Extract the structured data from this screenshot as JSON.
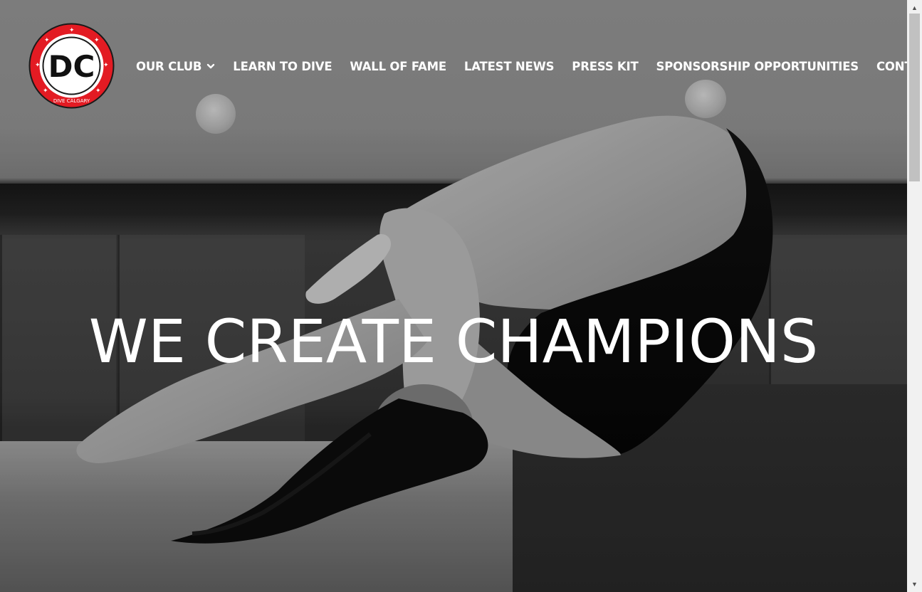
{
  "logo": {
    "initials": "DC",
    "ring_text": "DIVE CALGARY",
    "ring_color": "#e31b23"
  },
  "nav": {
    "items": [
      {
        "label": "OUR CLUB",
        "has_dropdown": true
      },
      {
        "label": "LEARN TO DIVE",
        "has_dropdown": false
      },
      {
        "label": "WALL OF FAME",
        "has_dropdown": false
      },
      {
        "label": "LATEST NEWS",
        "has_dropdown": false
      },
      {
        "label": "PRESS KIT",
        "has_dropdown": false
      },
      {
        "label": "SPONSORSHIP OPPORTUNITIES",
        "has_dropdown": false
      },
      {
        "label": "CONTACT",
        "has_dropdown": true
      }
    ],
    "dropdown_icon": "chevron-down-icon"
  },
  "hero": {
    "headline": "WE CREATE CHAMPIONS",
    "image": "diver-in-pike-position-black-and-white"
  },
  "scrollbar": {
    "up_icon": "triangle-up-icon",
    "down_icon": "triangle-down-icon"
  }
}
